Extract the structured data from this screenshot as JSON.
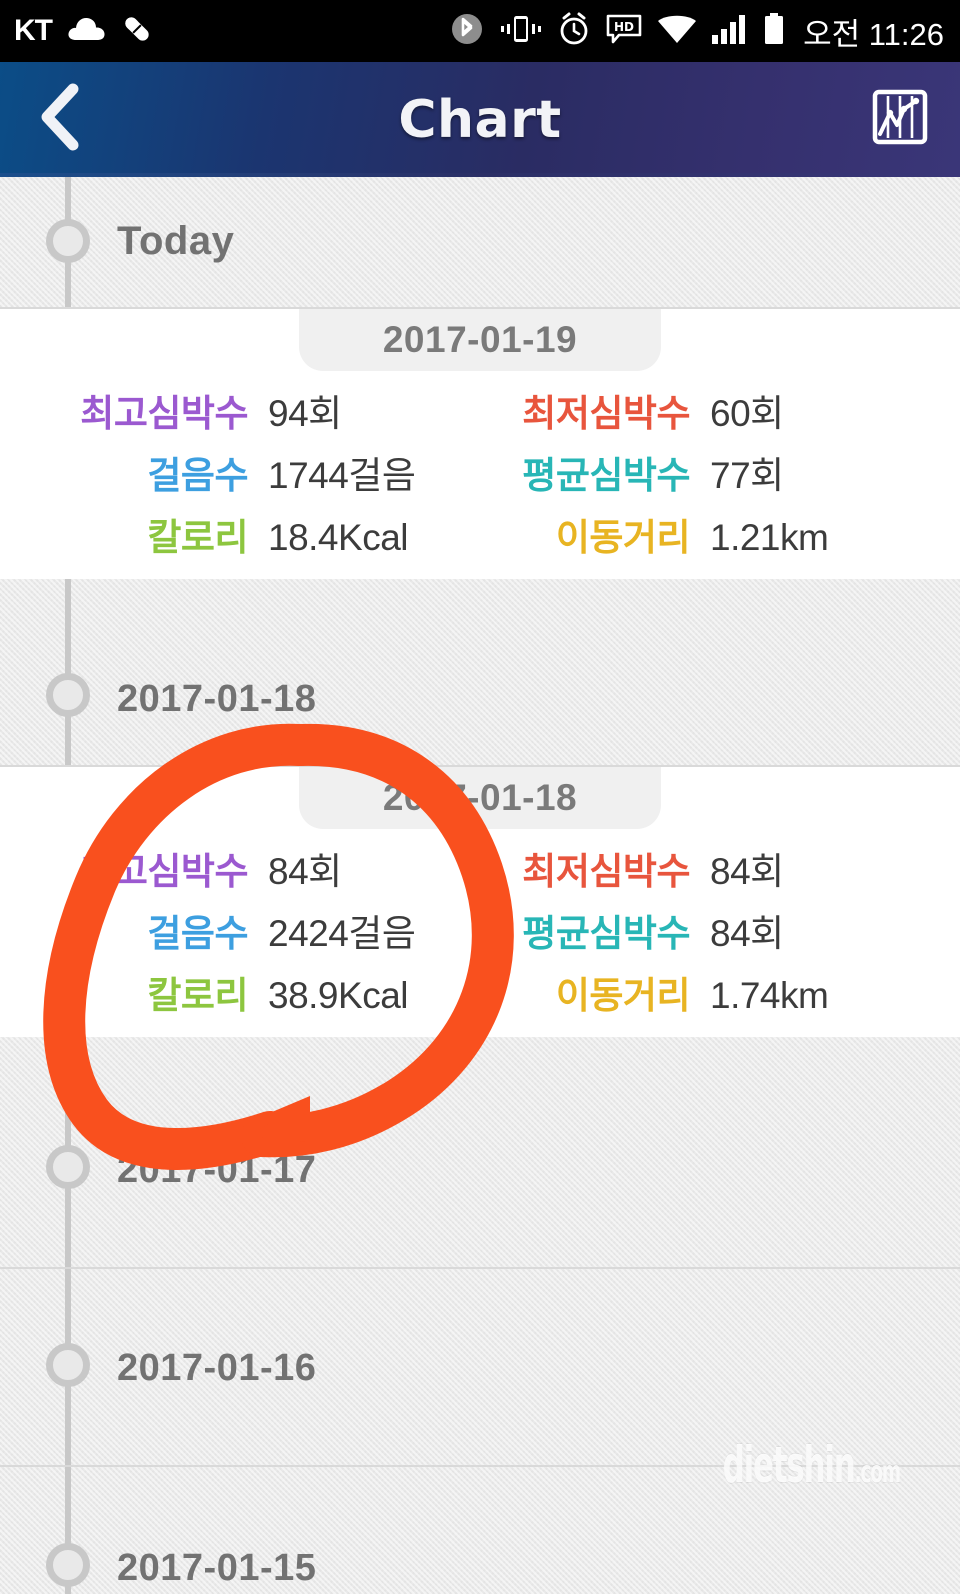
{
  "status_bar": {
    "carrier": "KT",
    "time": "오전 11:26",
    "icons": [
      "cloud-icon",
      "pill-icon",
      "bluetooth-icon",
      "vibrate-icon",
      "alarm-icon",
      "hd-message-icon",
      "wifi-icon",
      "signal-icon",
      "battery-icon"
    ]
  },
  "header": {
    "title": "Chart",
    "back_icon": "chevron-left-icon",
    "chart_icon": "chart-graph-icon"
  },
  "timeline": {
    "today_label": "Today",
    "entries": [
      {
        "label": "2017-01-18"
      },
      {
        "label": "2017-01-17"
      },
      {
        "label": "2017-01-16"
      },
      {
        "label": "2017-01-15"
      }
    ]
  },
  "metric_labels": {
    "max_hr": {
      "text": "최고심박수",
      "color": "#9b59d0"
    },
    "min_hr": {
      "text": "최저심박수",
      "color": "#e8553d"
    },
    "steps": {
      "text": "걸음수",
      "color": "#3d9fe0"
    },
    "avg_hr": {
      "text": "평균심박수",
      "color": "#28b6b6"
    },
    "calorie": {
      "text": "칼로리",
      "color": "#8dc63f"
    },
    "distance": {
      "text": "이동거리",
      "color": "#e8b422"
    }
  },
  "cards": [
    {
      "date": "2017-01-19",
      "max_hr": "94회",
      "min_hr": "60회",
      "steps": "1744걸음",
      "avg_hr": "77회",
      "calorie": "18.4Kcal",
      "distance": "1.21km"
    },
    {
      "date": "2017-01-18",
      "max_hr": "84회",
      "min_hr": "84회",
      "steps": "2424걸음",
      "avg_hr": "84회",
      "calorie": "38.9Kcal",
      "distance": "1.74km"
    }
  ],
  "watermark": {
    "name": "dietshin",
    "tld": ".com"
  },
  "annotation": {
    "shape": "hand-drawn-circle-with-arrow",
    "color": "#f9501e"
  }
}
